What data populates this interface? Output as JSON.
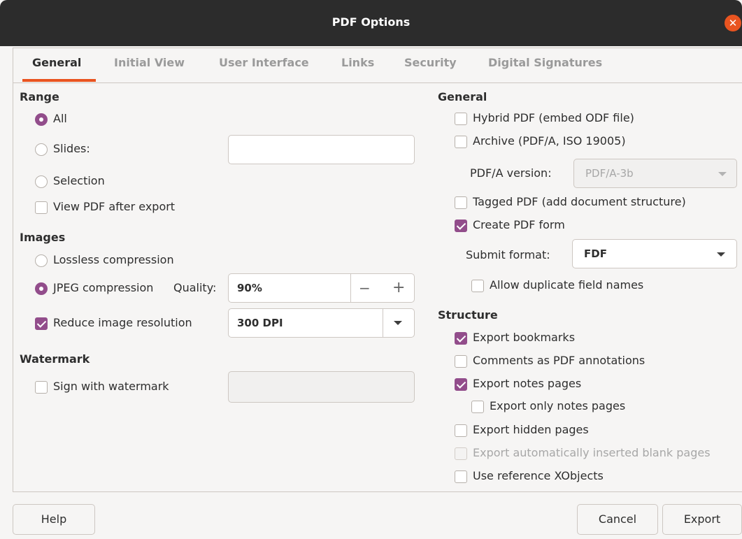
{
  "window": {
    "title": "PDF Options"
  },
  "tabs": [
    {
      "label": "General"
    },
    {
      "label": "Initial View"
    },
    {
      "label": "User Interface"
    },
    {
      "label": "Links"
    },
    {
      "label": "Security"
    },
    {
      "label": "Digital Signatures"
    }
  ],
  "left": {
    "range": {
      "title": "Range",
      "all": "All",
      "slides": "Slides:",
      "slides_value": "",
      "selection": "Selection",
      "view_after": "View PDF after export"
    },
    "images": {
      "title": "Images",
      "lossless": "Lossless compression",
      "jpeg": "JPEG compression",
      "quality_label": "Quality:",
      "quality_value": "90%",
      "minus": "−",
      "plus": "+",
      "reduce": "Reduce image resolution",
      "dpi_value": "300 DPI"
    },
    "watermark": {
      "title": "Watermark",
      "sign": "Sign with watermark",
      "text_value": ""
    }
  },
  "right": {
    "general": {
      "title": "General",
      "hybrid": "Hybrid PDF (embed ODF file)",
      "archive": "Archive (PDF/A, ISO 19005)",
      "pdfa_label": "PDF/A version:",
      "pdfa_value": "PDF/A-3b",
      "tagged": "Tagged PDF (add document structure)",
      "create_form": "Create PDF form",
      "submit_label": "Submit format:",
      "submit_value": "FDF",
      "allow_dup": "Allow duplicate field names"
    },
    "structure": {
      "title": "Structure",
      "export_bookmarks": "Export bookmarks",
      "comments": "Comments as PDF annotations",
      "export_notes": "Export notes pages",
      "export_only_notes": "Export only notes pages",
      "export_hidden": "Export hidden pages",
      "export_blank": "Export automatically inserted blank pages",
      "use_xobjects": "Use reference XObjects"
    }
  },
  "buttons": {
    "help": "Help",
    "cancel": "Cancel",
    "export": "Export"
  },
  "colors": {
    "accent": "#924d8b",
    "tab_underline": "#e95420",
    "titlebar": "#2c2c2c",
    "close": "#e95420"
  }
}
